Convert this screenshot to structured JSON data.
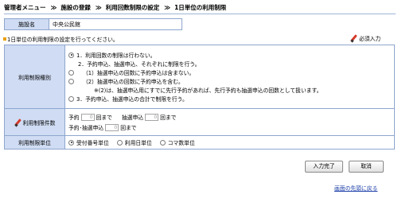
{
  "breadcrumb": {
    "items": [
      "管理者メニュー",
      "施設の登録",
      "利用回数制限の設定",
      "1日単位の利用制限"
    ],
    "separator": "≫"
  },
  "facility": {
    "label": "施設名",
    "value": "中央公民館"
  },
  "notice": "1日単位の利用制限の設定を行ってください。",
  "required_label": "必須入力",
  "restriction_type": {
    "label": "利用制限種別",
    "options": [
      "1．利用回数の制限は行わない。",
      "2．予約申込、抽選申込、それぞれに制限を行う。",
      "（1）抽選申込の回数に予約申込は含まない。",
      "（2）抽選申込の回数に予約申込を含む。",
      "※(2)は、抽選申込用にすでに先行予約があれば、先行予約も抽選申込の回数として扱います。",
      "3．予約申込、抽選申込の合計で制限を行う。"
    ],
    "selected_index": 0
  },
  "restriction_count": {
    "label": "利用制限件数",
    "reservation_label": "予約",
    "lottery_label": "抽選申込",
    "combined_label": "予約･抽選申込",
    "unit": "回まで",
    "reservation_value": "0",
    "lottery_value": "0",
    "combined_value": "0"
  },
  "restriction_unit": {
    "label": "利用制限単位",
    "options": [
      "受付番号単位",
      "利用日単位",
      "コマ数単位"
    ],
    "selected_index": 0
  },
  "buttons": {
    "submit": "入力完了",
    "cancel": "取消"
  },
  "back_to_top": "画面の先頭に戻る"
}
